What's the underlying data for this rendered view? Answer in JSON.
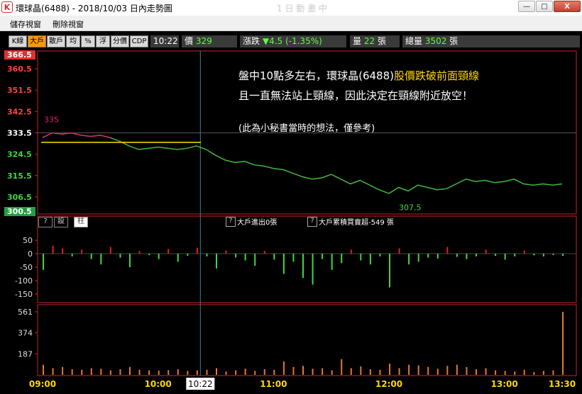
{
  "window": {
    "title": "環球晶(6488) - 2018/10/03 日內走勢圖",
    "ghost_text": "1 日 動 畫 中",
    "controls": {
      "minimize": "—",
      "maximize": "□",
      "close": "X"
    }
  },
  "menu": {
    "items": [
      "儲存視窗",
      "刪除視窗"
    ]
  },
  "toolbar": {
    "buttons": [
      "K線",
      "大戶",
      "散戶",
      "均",
      "%",
      "浮",
      "分價",
      "CDP"
    ],
    "active_index": 1,
    "time": "10:22",
    "price_label": "價",
    "price": "329",
    "change_label": "漲跌",
    "change": "▼4.5 (-1.35%)",
    "volume_label": "量",
    "volume": "22",
    "volume_unit": "張",
    "total_label": "總量",
    "total": "3502",
    "total_unit": "張"
  },
  "annotation": {
    "line1_prefix": "盤中10點多左右，環球晶(6488)",
    "line1_highlight": "股價跌破前面頸線",
    "line2": "且一直無法站上頸線，因此決定在頸線附近放空！",
    "line3": "(此為小秘書當時的想法，僅參考)"
  },
  "price_panel": {
    "y_ticks": [
      "366.5",
      "360.5",
      "351.5",
      "342.5",
      "333.5",
      "324.5",
      "315.5",
      "306.5",
      "300.5"
    ],
    "high_label": "335",
    "low_label": "307.5"
  },
  "flow_panel": {
    "buttons": [
      "?",
      "設",
      "柱"
    ],
    "big_flow_label": "大戶進出0張",
    "big_cum_label": "大戶累積買賣超-549 張",
    "y_ticks": [
      "50",
      "0",
      "-50",
      "-100",
      "-150"
    ]
  },
  "volume_panel": {
    "y_ticks": [
      "561",
      "374",
      "187"
    ]
  },
  "time_axis": {
    "ticks": [
      "09:00",
      "10:00",
      "11:00",
      "12:00",
      "13:00",
      "13:30"
    ],
    "cursor": "10:22"
  },
  "chart_data": {
    "type": "line",
    "ylim": [
      300.5,
      366.5
    ],
    "xlim": [
      "09:00",
      "13:30"
    ],
    "neckline": 329.5,
    "series": [
      {
        "x": [
          "09:00",
          "09:05",
          "09:10",
          "09:15",
          "09:20",
          "09:25",
          "09:30",
          "09:35",
          "09:40",
          "09:45",
          "09:50",
          "09:55",
          "10:00",
          "10:05",
          "10:10",
          "10:15",
          "10:20",
          "10:25",
          "10:30",
          "10:35",
          "10:40",
          "10:45",
          "10:50",
          "10:55",
          "11:00",
          "11:05",
          "11:10",
          "11:15",
          "11:20",
          "11:25",
          "11:30",
          "11:35",
          "11:40",
          "11:45",
          "11:50",
          "11:55",
          "12:00",
          "12:05",
          "12:10",
          "12:15",
          "12:20",
          "12:25",
          "12:30",
          "12:35",
          "12:40",
          "12:45",
          "12:50",
          "12:55",
          "13:00",
          "13:05",
          "13:10",
          "13:15",
          "13:20",
          "13:25",
          "13:30"
        ],
        "values": [
          331.5,
          333.5,
          333,
          333.5,
          332.5,
          332,
          332.5,
          331.5,
          330,
          328,
          326.5,
          327,
          327.5,
          327,
          326.5,
          327,
          328,
          326.5,
          324,
          322,
          321,
          321.5,
          320,
          319.5,
          318.5,
          318,
          316.5,
          315,
          314,
          314.5,
          316,
          314,
          312,
          313.5,
          311.5,
          309.5,
          308,
          310.5,
          309,
          311.5,
          310.5,
          309.5,
          310,
          312,
          314,
          313,
          313.5,
          312.5,
          313,
          314,
          312,
          311.5,
          312,
          311.5,
          312
        ]
      }
    ]
  },
  "flow_data": [
    -60,
    30,
    20,
    -10,
    15,
    -20,
    -40,
    25,
    -15,
    -50,
    10,
    -5,
    -20,
    18,
    -30,
    -8,
    22,
    -10,
    -55,
    12,
    -14,
    -25,
    -45,
    10,
    -22,
    -75,
    -30,
    -90,
    -115,
    -20,
    -60,
    -35,
    15,
    -25,
    -40,
    -10,
    -125,
    20,
    -40,
    -30,
    -15,
    -18,
    25,
    -12,
    -20,
    -10,
    15,
    -8,
    -22,
    -10,
    12,
    -6,
    -10,
    -5,
    -8
  ],
  "volume_data": [
    90,
    60,
    70,
    50,
    45,
    60,
    55,
    40,
    50,
    70,
    45,
    40,
    38,
    42,
    50,
    35,
    40,
    45,
    60,
    30,
    40,
    55,
    35,
    50,
    45,
    120,
    70,
    80,
    55,
    60,
    40,
    140,
    60,
    75,
    50,
    45,
    100,
    60,
    90,
    85,
    70,
    55,
    80,
    90,
    70,
    50,
    60,
    40,
    35,
    30,
    45,
    25,
    35,
    40,
    561
  ]
}
